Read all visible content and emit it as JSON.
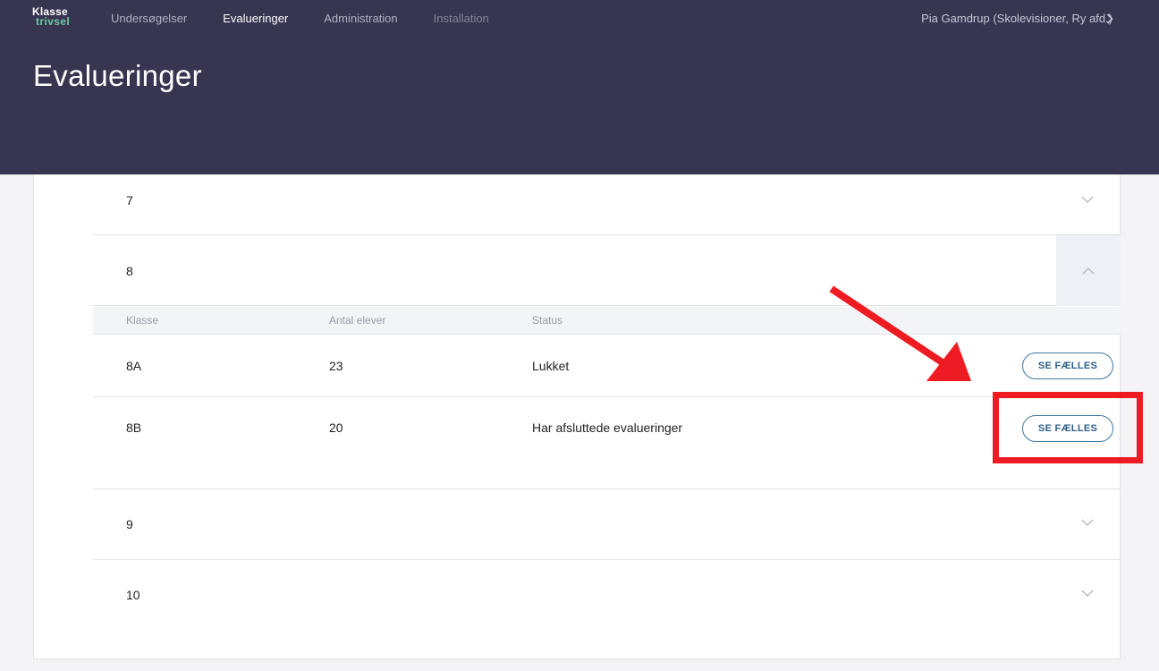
{
  "header": {
    "logo_line1": "Klasse",
    "logo_line2": "trivsel",
    "nav": [
      {
        "label": "Undersøgelser",
        "state": "normal"
      },
      {
        "label": "Evalueringer",
        "state": "active"
      },
      {
        "label": "Administration",
        "state": "normal"
      },
      {
        "label": "Installation",
        "state": "dim"
      }
    ],
    "user": "Pia Gamdrup (Skolevisioner, Ry afd.)",
    "title": "Evalueringer"
  },
  "groups": {
    "g7": "7",
    "g8": "8",
    "g9": "9",
    "g10": "10"
  },
  "table": {
    "headers": {
      "klasse": "Klasse",
      "antal": "Antal elever",
      "status": "Status"
    },
    "rows": [
      {
        "klasse": "8A",
        "antal": "23",
        "status": "Lukket",
        "button": "SE FÆLLES"
      },
      {
        "klasse": "8B",
        "antal": "20",
        "status": "Har afsluttede evalueringer",
        "button": "SE FÆLLES"
      }
    ]
  },
  "icons": {
    "collapse": "chevron-down-icon",
    "expand": "chevron-up-icon",
    "user_menu": "chevron-right-icon",
    "annotation": "red-arrow"
  },
  "colors": {
    "header_bg": "#383551",
    "accent_green": "#6fc7a6",
    "button_border": "#3c79a4",
    "annotation_red": "#ee1c22"
  }
}
